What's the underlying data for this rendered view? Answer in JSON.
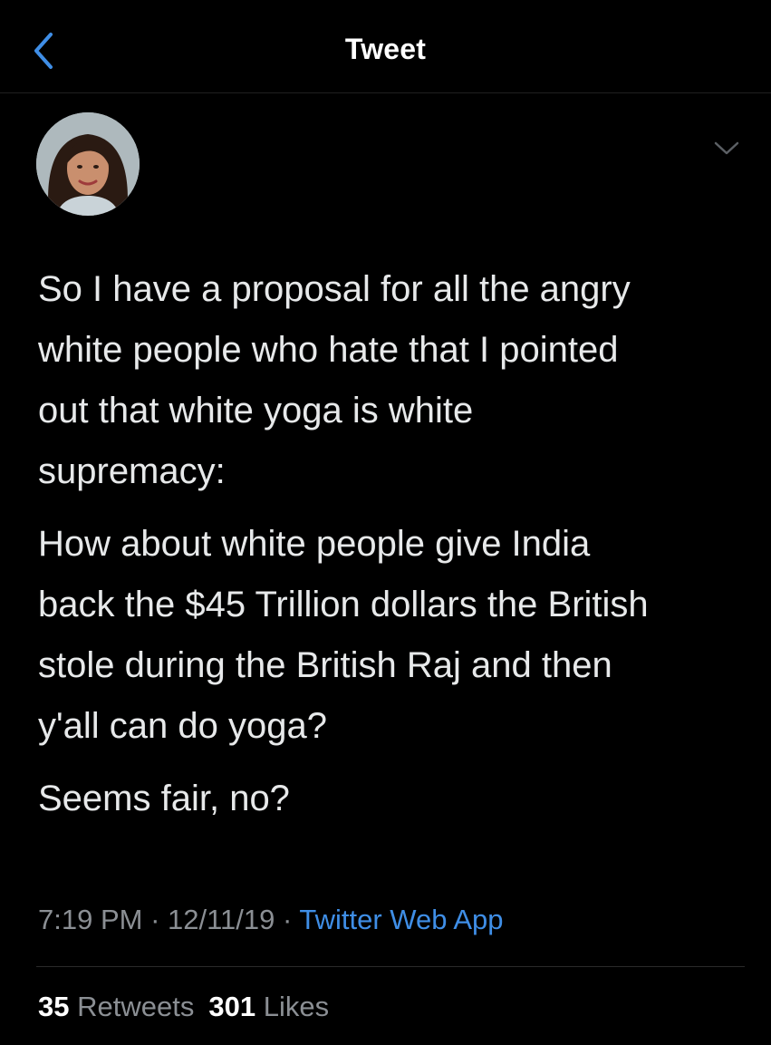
{
  "header": {
    "title": "Tweet",
    "back_icon": "chevron-left-icon"
  },
  "colors": {
    "background": "#000000",
    "text": "#e7e9ea",
    "muted": "#8b8f94",
    "accent": "#3f8ee6"
  },
  "tweet": {
    "avatar_icon": "profile-photo",
    "menu_icon": "chevron-down-icon",
    "paragraphs": [
      "So I have a proposal for all the angry\nwhite people who hate that I pointed\nout that white yoga is white\nsupremacy:",
      "How about white people give India\nback the $45 Trillion dollars the British\nstole during the British Raj and then\ny'all can do yoga?",
      "Seems fair, no?"
    ],
    "time": "7:19 PM",
    "separator": " · ",
    "date": "12/11/19",
    "source": "Twitter Web App"
  },
  "stats": {
    "retweets_count": "35",
    "retweets_label": "Retweets",
    "likes_count": "301",
    "likes_label": "Likes"
  }
}
